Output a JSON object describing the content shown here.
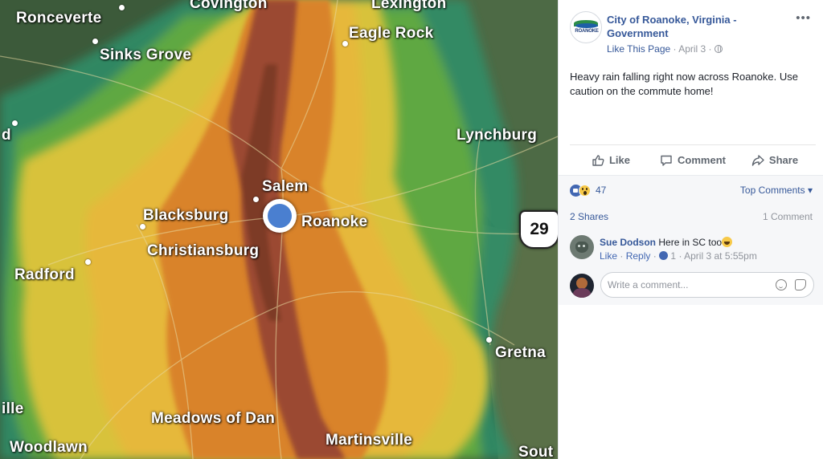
{
  "map": {
    "cities": [
      {
        "id": "ronceverte",
        "label": "Ronceverte"
      },
      {
        "id": "covington",
        "label": "Covington"
      },
      {
        "id": "lexington",
        "label": "Lexington"
      },
      {
        "id": "eagle-rock",
        "label": "Eagle Rock"
      },
      {
        "id": "sinks-grove",
        "label": "Sinks Grove"
      },
      {
        "id": "lynchburg",
        "label": "Lynchburg"
      },
      {
        "id": "salem",
        "label": "Salem"
      },
      {
        "id": "blacksburg",
        "label": "Blacksburg"
      },
      {
        "id": "roanoke",
        "label": "Roanoke"
      },
      {
        "id": "christiansburg",
        "label": "Christiansburg"
      },
      {
        "id": "radford",
        "label": "Radford"
      },
      {
        "id": "gretna",
        "label": "Gretna"
      },
      {
        "id": "meadows-of-dan",
        "label": "Meadows of Dan"
      },
      {
        "id": "martinsville",
        "label": "Martinsville"
      },
      {
        "id": "woodlawn",
        "label": "Woodlawn"
      },
      {
        "id": "ille",
        "label": "ille"
      },
      {
        "id": "d",
        "label": "d"
      },
      {
        "id": "sout",
        "label": "Sout"
      }
    ],
    "highway_shield": "29",
    "colors": {
      "heavy": "#8a3a2a",
      "moderate": "#d9832c",
      "light": "#e7c23a",
      "drizzle": "#9cc03a",
      "ground": "#3c5a3a"
    }
  },
  "post": {
    "page_name": "City of Roanoke, Virginia - Government",
    "avatar_text": "ROANOKE",
    "like_page": "Like This Page",
    "date": "April 3",
    "more_icon": "more-icon",
    "text": "Heavy rain falling right now across Roanoke. Use caution on the commute home!",
    "actions": {
      "like": "Like",
      "comment": "Comment",
      "share": "Share"
    },
    "reaction_count": "47",
    "top_comments": "Top Comments",
    "shares": "2 Shares",
    "comments_count": "1 Comment",
    "comment": {
      "author": "Sue Dodson",
      "text": "Here in SC too",
      "like": "Like",
      "reply": "Reply",
      "likes": "1",
      "timestamp": "April 3 at 5:55pm"
    },
    "write_placeholder": "Write a comment...",
    "brand_color": "#365899"
  }
}
